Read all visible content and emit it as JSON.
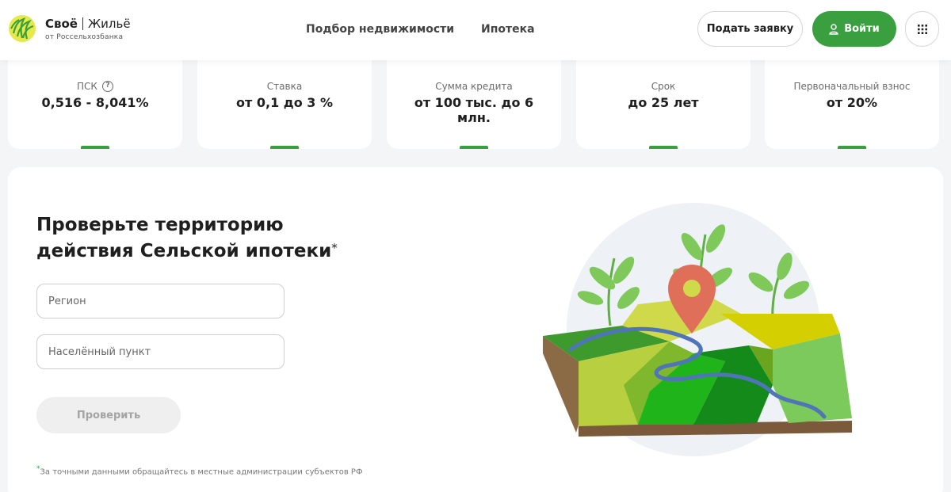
{
  "header": {
    "brand_main": "Своё",
    "brand_second": "Жильё",
    "brand_sub": "от Россельхозбанка",
    "nav": [
      "Подбор недвижимости",
      "Ипотека"
    ],
    "apply_label": "Подать заявку",
    "login_label": "Войти"
  },
  "stats": [
    {
      "label": "ПСК",
      "value": "0,516 - 8,041%",
      "has_info": true
    },
    {
      "label": "Ставка",
      "value": "от 0,1 до 3 %"
    },
    {
      "label": "Сумма кредита",
      "value": "от 100 тыс. до 6 млн."
    },
    {
      "label": "Срок",
      "value": "до 25 лет"
    },
    {
      "label": "Первоначальный взнос",
      "value": "от 20%"
    }
  ],
  "form": {
    "title_line1": "Проверьте территорию",
    "title_line2": "действия Сельской ипотеки",
    "title_mark": "*",
    "region_placeholder": "Регион",
    "locality_placeholder": "Населённый пункт",
    "submit_label": "Проверить",
    "footnote_mark": "*",
    "footnote": "За точными данными обращайтесь в местные администрации субъектов РФ"
  },
  "colors": {
    "accent": "#3a9f3f",
    "pin": "#e06f5a",
    "page_bg": "#f3f5f7"
  },
  "icons": {
    "info": "question-circle-icon",
    "login": "user-icon",
    "menu": "grid-dots-icon",
    "logo": "leaf-logo"
  }
}
